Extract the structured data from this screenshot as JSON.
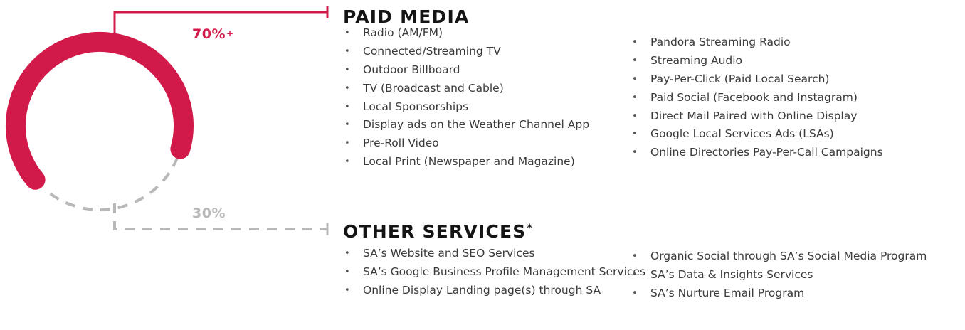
{
  "chart_data": {
    "type": "donut",
    "segments": [
      {
        "label": "PAID MEDIA",
        "value_label": "70%",
        "value_suffix": "+",
        "value": 70,
        "color": "#d11a4a",
        "style": "solid"
      },
      {
        "label": "OTHER SERVICES",
        "value_label": "30%",
        "value": 30,
        "color": "#b8b8b8",
        "style": "dashed"
      }
    ]
  },
  "paid": {
    "heading": "PAID MEDIA",
    "percent": "70%",
    "percent_suffix": "+",
    "col1": [
      "Radio (AM/FM)",
      "Connected/Streaming TV",
      "Outdoor Billboard",
      "TV (Broadcast and Cable)",
      "Local Sponsorships",
      "Display ads on the Weather Channel App",
      "Pre-Roll Video",
      "Local Print (Newspaper and Magazine)"
    ],
    "col2": [
      "Pandora Streaming Radio",
      "Streaming Audio",
      "Pay-Per-Click (Paid Local Search)",
      "Paid Social (Facebook and Instagram)",
      "Direct Mail Paired with Online Display",
      "Google Local Services Ads (LSAs)",
      "Online Directories Pay-Per-Call Campaigns"
    ]
  },
  "other": {
    "heading": "OTHER SERVICES",
    "heading_mark": "*",
    "percent": "30%",
    "col1": [
      "SA’s Website and SEO Services",
      "SA’s Google Business Profile Management Services",
      "Online Display Landing page(s) through SA"
    ],
    "col2": [
      "Organic Social through SA’s Social Media Program",
      "SA’s Data & Insights Services",
      "SA’s Nurture Email Program"
    ]
  },
  "bullet": "•"
}
